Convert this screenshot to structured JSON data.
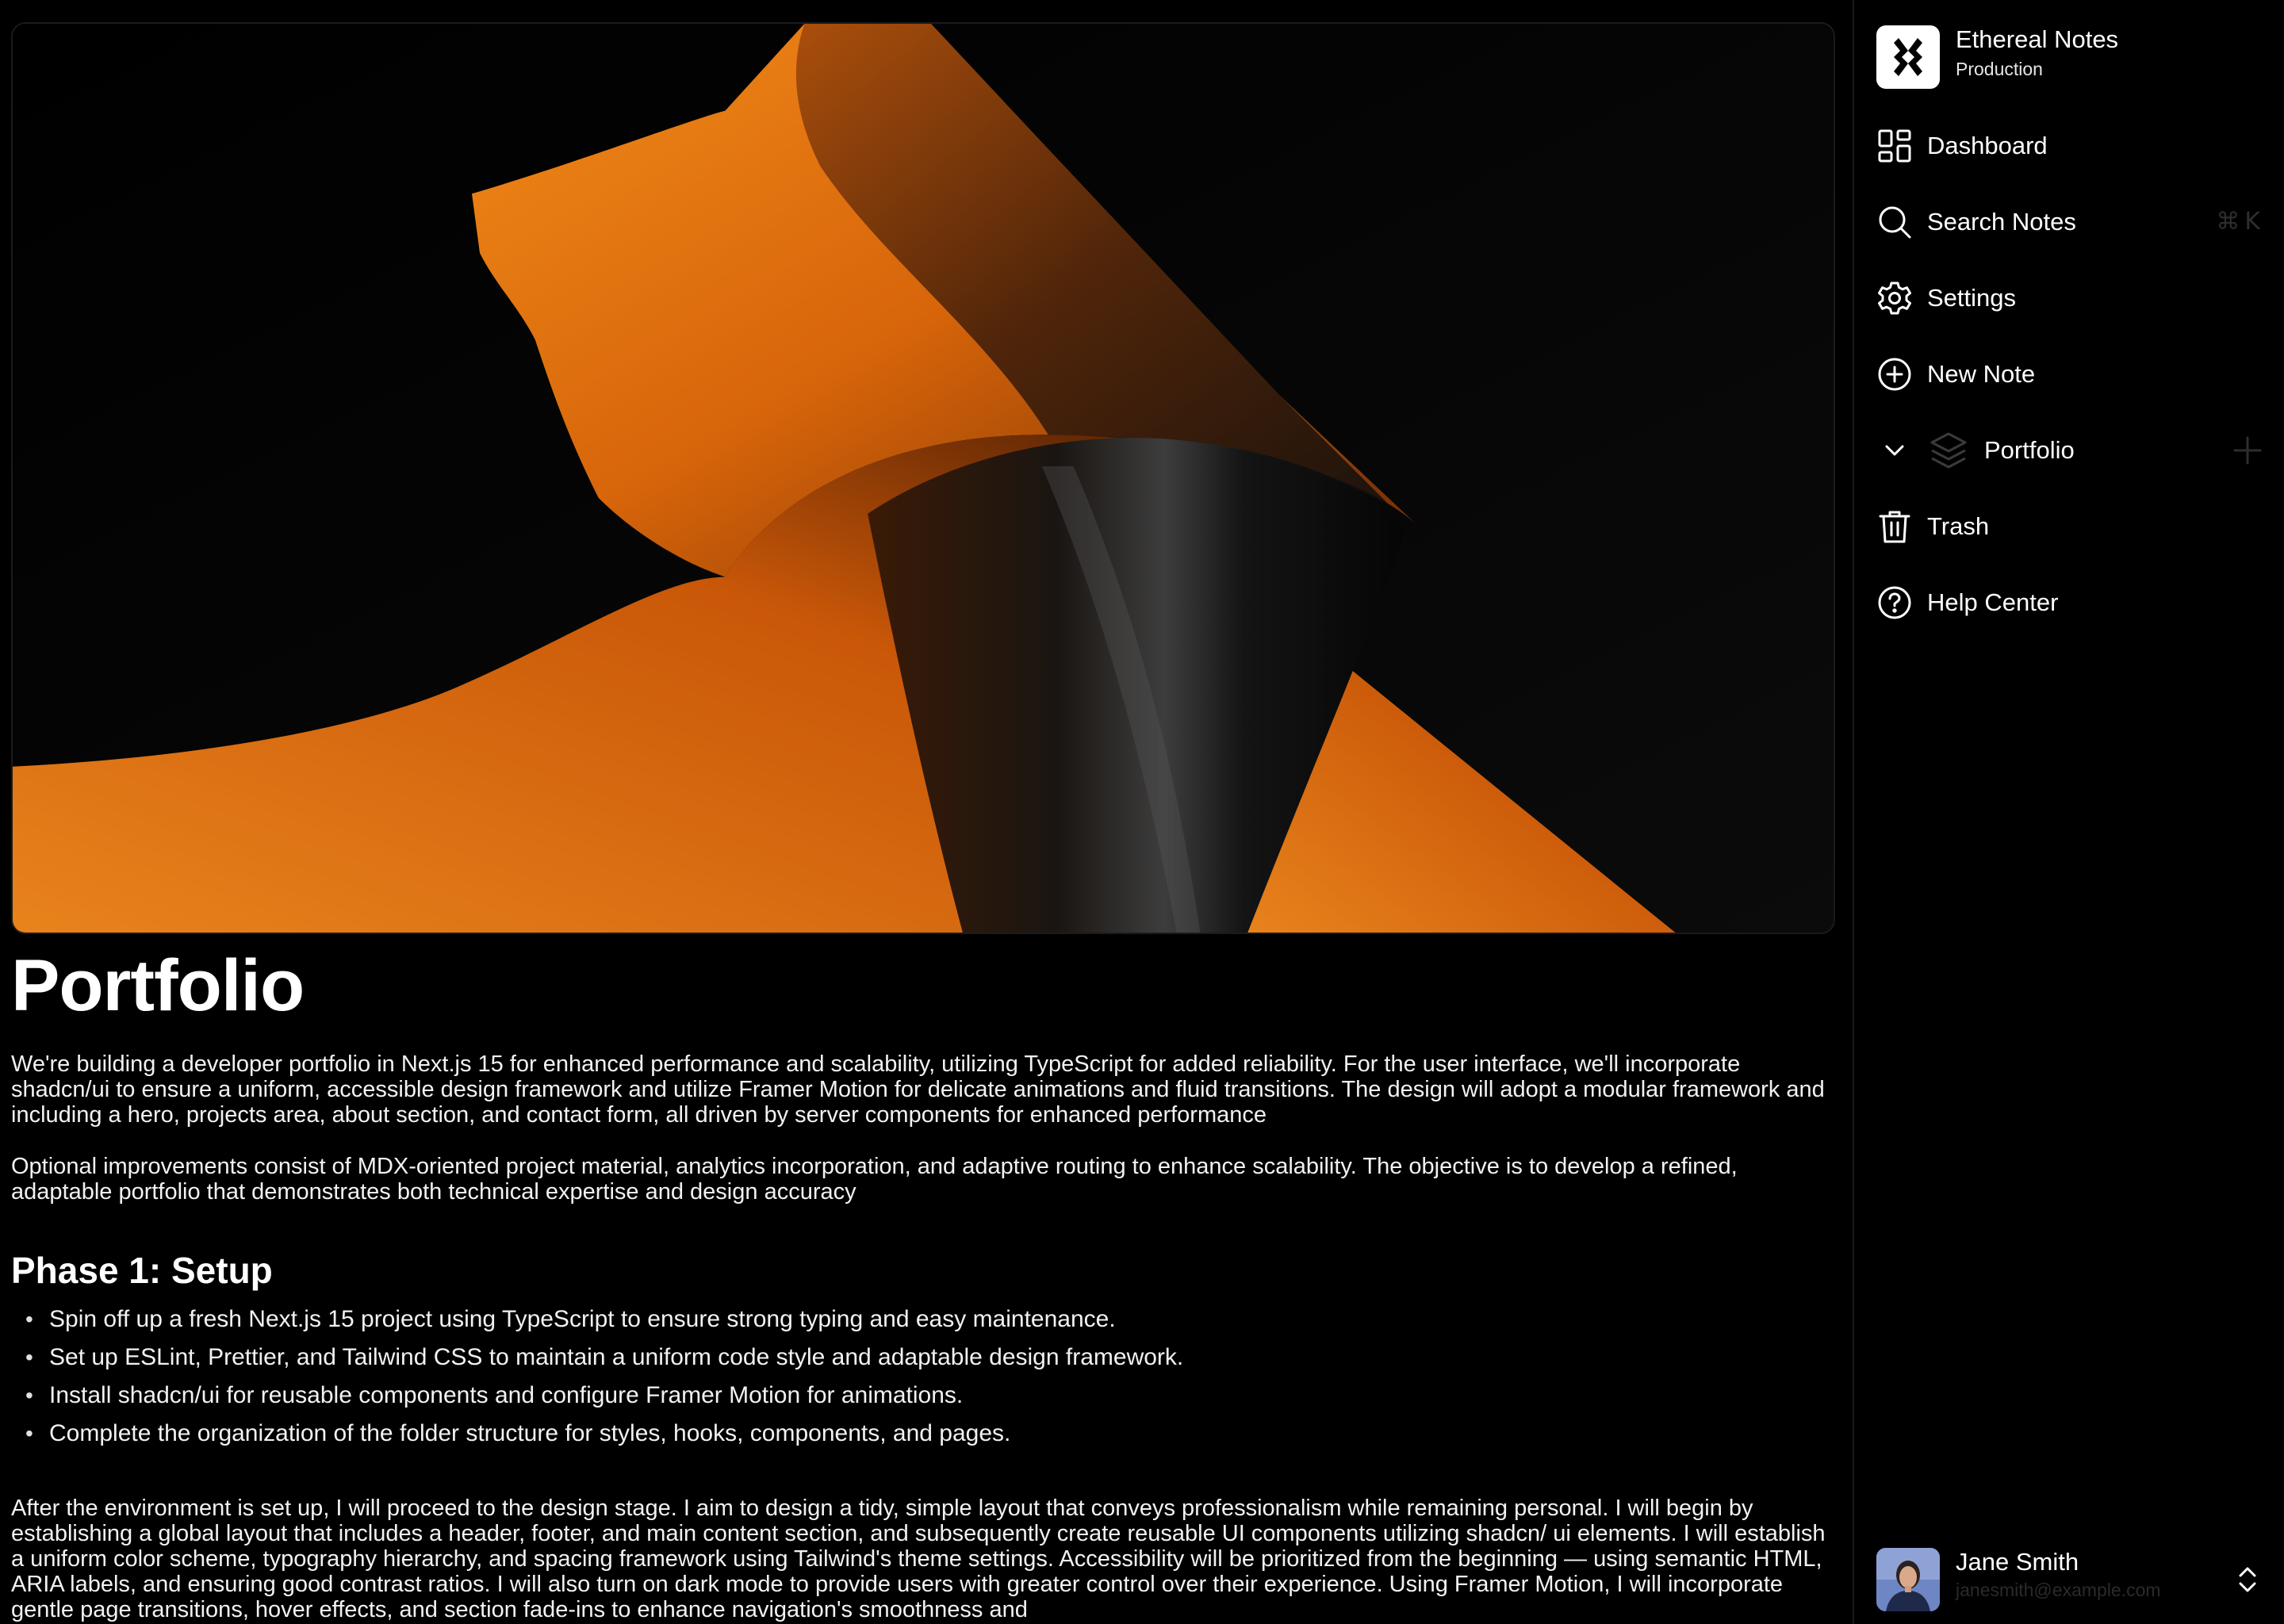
{
  "workspace": {
    "name": "Ethereal Notes",
    "environment": "Production"
  },
  "sidebar": {
    "items": [
      {
        "label": "Dashboard",
        "icon": "dashboard-icon"
      },
      {
        "label": "Search Notes",
        "icon": "search-icon",
        "shortcut": "⌘K"
      },
      {
        "label": "Settings",
        "icon": "gear-icon"
      },
      {
        "label": "New Note",
        "icon": "plus-circle-icon"
      },
      {
        "label": "Portfolio",
        "icon": "layers-icon",
        "expanded": false
      },
      {
        "label": "Trash",
        "icon": "trash-icon"
      },
      {
        "label": "Help Center",
        "icon": "help-circle-icon"
      }
    ]
  },
  "user": {
    "name": "Jane Smith",
    "email": "janesmith@example.com"
  },
  "note": {
    "title": "Portfolio",
    "paragraph1": "We're building a developer portfolio in Next.js 15 for enhanced performance and scalability, utilizing TypeScript for added reliability. For the user interface, we'll incorporate shadcn/ui to ensure a uniform, accessible design framework and utilize Framer Motion for delicate animations and fluid transitions. The design will adopt a modular framework and including a hero, projects area, about section, and contact form, all driven by server components for enhanced performance",
    "paragraph2": "Optional improvements consist of MDX-oriented project material, analytics incorporation, and adaptive routing to enhance scalability. The objective is to develop a refined, adaptable portfolio that demonstrates both technical expertise and design accuracy",
    "phase_heading": "Phase 1: Setup",
    "bullets": [
      "Spin off up a fresh Next.js 15 project using TypeScript to ensure strong typing and easy maintenance.",
      "Set up ESLint, Prettier, and Tailwind CSS to maintain a uniform code style and adaptable design framework.",
      "Install shadcn/ui for reusable components and configure Framer Motion for animations.",
      "Complete the organization of the folder structure for styles, hooks, components, and pages."
    ],
    "paragraph3": "After the environment is set up, I will proceed to the design stage. I aim to design a tidy, simple layout that conveys professionalism while remaining personal. I will begin by establishing a global layout that includes a header, footer, and main content section, and subsequently create reusable UI components utilizing shadcn/ ui elements. I will establish a uniform color scheme, typography hierarchy, and spacing framework using Tailwind's theme settings. Accessibility will be prioritized from the beginning — using semantic HTML, ARIA labels, and ensuring good contrast ratios. I will also turn on dark mode to provide users with greater control over their experience. Using Framer Motion, I will incorporate gentle page transitions, hover effects, and section fade-ins to enhance navigation's smoothness and"
  },
  "colors": {
    "background": "#000000",
    "accent_orange": "#e37a10",
    "text": "#ffffff",
    "muted": "#2e2e2e"
  }
}
